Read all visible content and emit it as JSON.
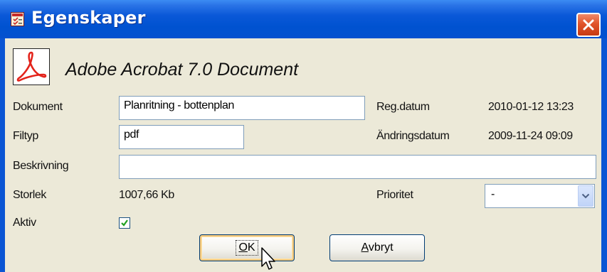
{
  "window": {
    "title": "Egenskaper",
    "title_icon": "properties-icon",
    "close_icon": "close-icon"
  },
  "header": {
    "file_icon": "pdf-icon",
    "document_type": "Adobe Acrobat 7.0 Document"
  },
  "fields": {
    "document": {
      "label": "Dokument",
      "value": "Planritning - bottenplan"
    },
    "filetype": {
      "label": "Filtyp",
      "value": "pdf"
    },
    "description": {
      "label": "Beskrivning",
      "value": ""
    },
    "size": {
      "label": "Storlek",
      "value": "1007,66 Kb"
    },
    "active": {
      "label": "Aktiv",
      "checked": true
    },
    "reg_date": {
      "label": "Reg.datum",
      "value": "2010-01-12 13:23"
    },
    "modified_date": {
      "label": "Ändringsdatum",
      "value": "2009-11-24 09:09"
    },
    "priority": {
      "label": "Prioritet",
      "value": "-"
    }
  },
  "buttons": {
    "ok": "OK",
    "ok_mnemonic": "O",
    "ok_rest": "K",
    "cancel": "Avbryt",
    "cancel_mnemonic": "A",
    "cancel_rest": "vbryt"
  },
  "colors": {
    "titlebar": "#0a58d8",
    "client": "#ece9d8",
    "close": "#e1542b",
    "pdf_red": "#e3231b"
  }
}
